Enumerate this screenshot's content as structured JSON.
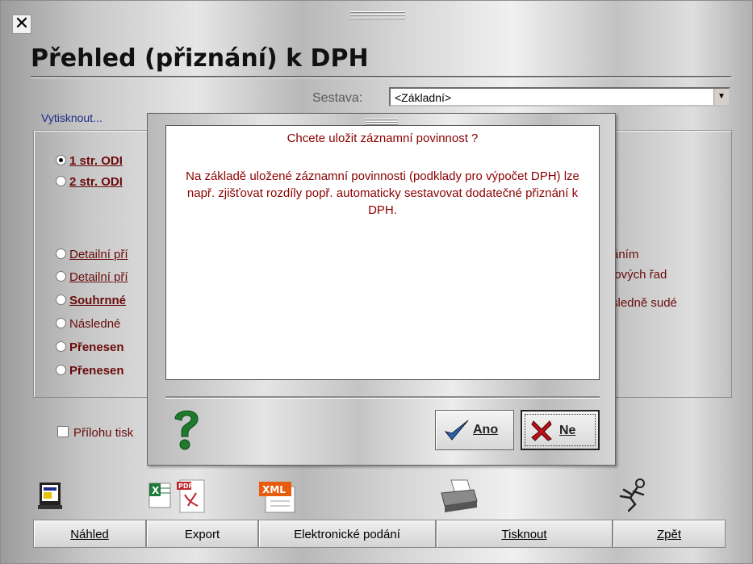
{
  "window": {
    "title": "Přehled (přiznání) k DPH",
    "close_glyph": "✕"
  },
  "sestava": {
    "label": "Sestava:",
    "value": "<Základní>",
    "arrow": "▼"
  },
  "vytisknout_label": "Vytisknout...",
  "options": [
    {
      "label": "1 str. ODI",
      "selected": true
    },
    {
      "label": "2 str. ODI",
      "selected": false
    },
    {
      "label": "Detailní pří",
      "selected": false
    },
    {
      "label": "Detailní pří",
      "selected": false
    },
    {
      "label": "Souhrnné",
      "selected": false
    },
    {
      "label": "Následné",
      "selected": false
    },
    {
      "label": "Přenesen",
      "selected": false
    },
    {
      "label": "Přenesen",
      "selected": false
    }
  ],
  "right_fragments": [
    "áním",
    "lových řad",
    "sledně sudé"
  ],
  "attachment_checkbox": {
    "label": "Přílohu tisk",
    "checked": false
  },
  "toolbar": {
    "buttons": [
      "Náhled",
      "Export",
      "Elektronické podání",
      "Tisknout",
      "Zpět"
    ],
    "icons": [
      "preview-icon",
      "export-excel-pdf-icon",
      "xml-icon",
      "printer-icon",
      "running-man-icon"
    ]
  },
  "dialog": {
    "question": "Chcete uložit záznamní povinnost ?",
    "description": "Na základě uložené záznamní povinnosti (podklady pro výpočet DPH) lze např. zjišťovat rozdíly popř. automaticky sestavovat dodatečné přiznání k DPH.",
    "yes_label": "Ano",
    "no_label": "Ne",
    "help_icon": "question-mark-icon"
  },
  "colors": {
    "text_dark_red": "#6a0b0b",
    "link_blue": "#1b2d8a",
    "help_green": "#1e7a2c"
  }
}
